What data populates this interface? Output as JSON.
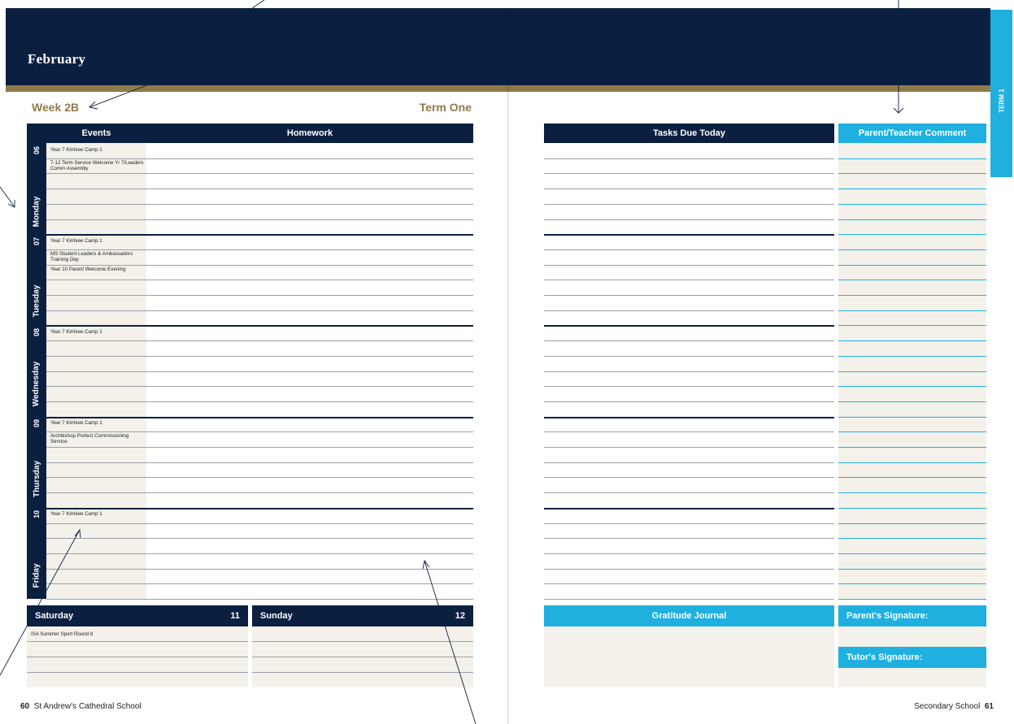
{
  "header": {
    "month": "February",
    "term_tab": "TERM 1"
  },
  "left_page": {
    "week": "Week 2B",
    "term": "Term One",
    "columns": {
      "events": "Events",
      "homework": "Homework"
    },
    "days": [
      {
        "num": "06",
        "name": "Monday",
        "events": [
          "Year 7 Kirrikee Camp 1",
          "7-12 Term Service Welcome Yr 7/Leaders Comm Assembly"
        ]
      },
      {
        "num": "07",
        "name": "Tuesday",
        "events": [
          "Year 7 Kirrikee Camp 1",
          "MS Student Leaders & Ambassadors Training Day",
          "Year 10 Parent Welcome Evening"
        ]
      },
      {
        "num": "08",
        "name": "Wednesday",
        "events": [
          "Year 7 Kirrikee Camp 1"
        ]
      },
      {
        "num": "09",
        "name": "Thursday",
        "events": [
          "Year 7 Kirrikee Camp 1",
          "Archbishop Prefect Commissioning Service"
        ]
      },
      {
        "num": "10",
        "name": "Friday",
        "events": [
          "Year 7 Kirrikee Camp 1"
        ]
      }
    ],
    "weekend": [
      {
        "name": "Saturday",
        "num": "11",
        "events": [
          "ISA Summer Sport Round 8"
        ]
      },
      {
        "name": "Sunday",
        "num": "12",
        "events": []
      }
    ],
    "footer": {
      "page": "60",
      "school": "St Andrew's Cathedral School"
    }
  },
  "right_page": {
    "tasks_heading": "Tasks Due Today",
    "comment_heading": "Parent/Teacher Comment",
    "gratitude_heading": "Gratitude Journal",
    "parent_signature": "Parent's Signature:",
    "tutor_signature": "Tutor's Signature:",
    "footer": {
      "section": "Secondary School",
      "page": "61"
    }
  },
  "colors": {
    "navy": "#0b2040",
    "gold": "#8f7a4a",
    "cyan": "#1fb0df",
    "cream": "#f4f1ea"
  }
}
